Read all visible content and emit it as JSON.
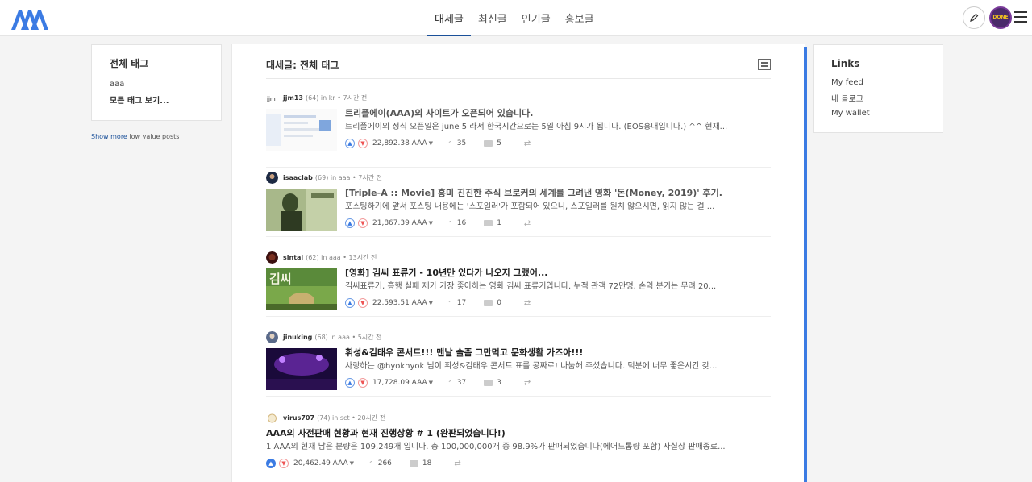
{
  "header": {
    "tabs": [
      {
        "label": "대세글"
      },
      {
        "label": "최신글"
      },
      {
        "label": "인기글"
      },
      {
        "label": "홍보글"
      }
    ],
    "active_tab": 0,
    "avatar_text": "DONE",
    "brand_color": "#1a5099",
    "accent_color": "#3b7be3"
  },
  "left_sidebar": {
    "title": "전체 태그",
    "tags": [
      "aaa"
    ],
    "more_label": "모든 태그 보기...",
    "show_more_link": "Show more",
    "show_more_suffix": " low value posts"
  },
  "main": {
    "title": "대세글: 전체 태그",
    "posts": [
      {
        "author": "jjm13",
        "reputation": "(64)",
        "community": "kr",
        "time": "7시간 전",
        "title": "트리플에이(AAA)의 사이트가 오픈되어 있습니다.",
        "excerpt": "트리플에이의 정식 오픈일은 june 5 라서 한국시간으로는 5일 아침 9시가 됩니다. (EOS홍내입니다.) ^^ 현재...",
        "payout": "22,892.38 AAA",
        "votes": "35",
        "comments": "5",
        "title_dark": false
      },
      {
        "author": "isaaclab",
        "reputation": "(69)",
        "community": "aaa",
        "time": "7시간 전",
        "title": "[Triple-A :: Movie] 흥미 진진한 주식 브로커의 세계를 그려낸 영화 '돈(Money, 2019)' 후기.",
        "excerpt": "포스팅하기에 앞서 포스팅 내용에는 '스포일러'가 포함되어 있으니, 스포일러를 원치 않으시면, 읽지 않는 걸 ...",
        "payout": "21,867.39 AAA",
        "votes": "16",
        "comments": "1",
        "title_dark": false
      },
      {
        "author": "sintai",
        "reputation": "(62)",
        "community": "aaa",
        "time": "13시간 전",
        "title": "[영화] 김씨 표류기 - 10년만 있다가 나오지 그랬어...",
        "excerpt": "김씨표류기, 흥행 실패 제가 가장 좋아하는 영화 김씨 표류기입니다. 누적 관객 72만명. 손익 분기는 무려 20...",
        "payout": "22,593.51 AAA",
        "votes": "17",
        "comments": "0",
        "title_dark": true
      },
      {
        "author": "jinuking",
        "reputation": "(68)",
        "community": "aaa",
        "time": "5시간 전",
        "title": "휘성&김태우 콘서트!!! 맨날 술좀 그만먹고 문화생활 가즈아!!!",
        "excerpt": "사랑하는 @hyokhyok 님이 휘성&김태우 콘서트 표를 공짜로! 나눔해 주셨습니다. 덕분에 너무 좋은시간 갖...",
        "payout": "17,728.09 AAA",
        "votes": "37",
        "comments": "3",
        "title_dark": true
      },
      {
        "author": "virus707",
        "reputation": "(74)",
        "community": "sct",
        "time": "20시간 전",
        "title": "AAA의 사전판매 현황과 현재 진행상황 # 1 (완판되었습니다!)",
        "excerpt": "1 AAA의 현재 남은 분량은 109,249개 입니다. 총 100,000,000개 중 98.9%가 판매되었습니다(에어드롭량 포함) 사실상 판매종료...",
        "payout": "20,462.49 AAA",
        "votes": "266",
        "comments": "18",
        "title_dark": true
      }
    ],
    "in_label": "in",
    "dot": "•"
  },
  "right_sidebar": {
    "title": "Links",
    "links": [
      "My feed",
      "내 블로그",
      "My wallet"
    ]
  }
}
